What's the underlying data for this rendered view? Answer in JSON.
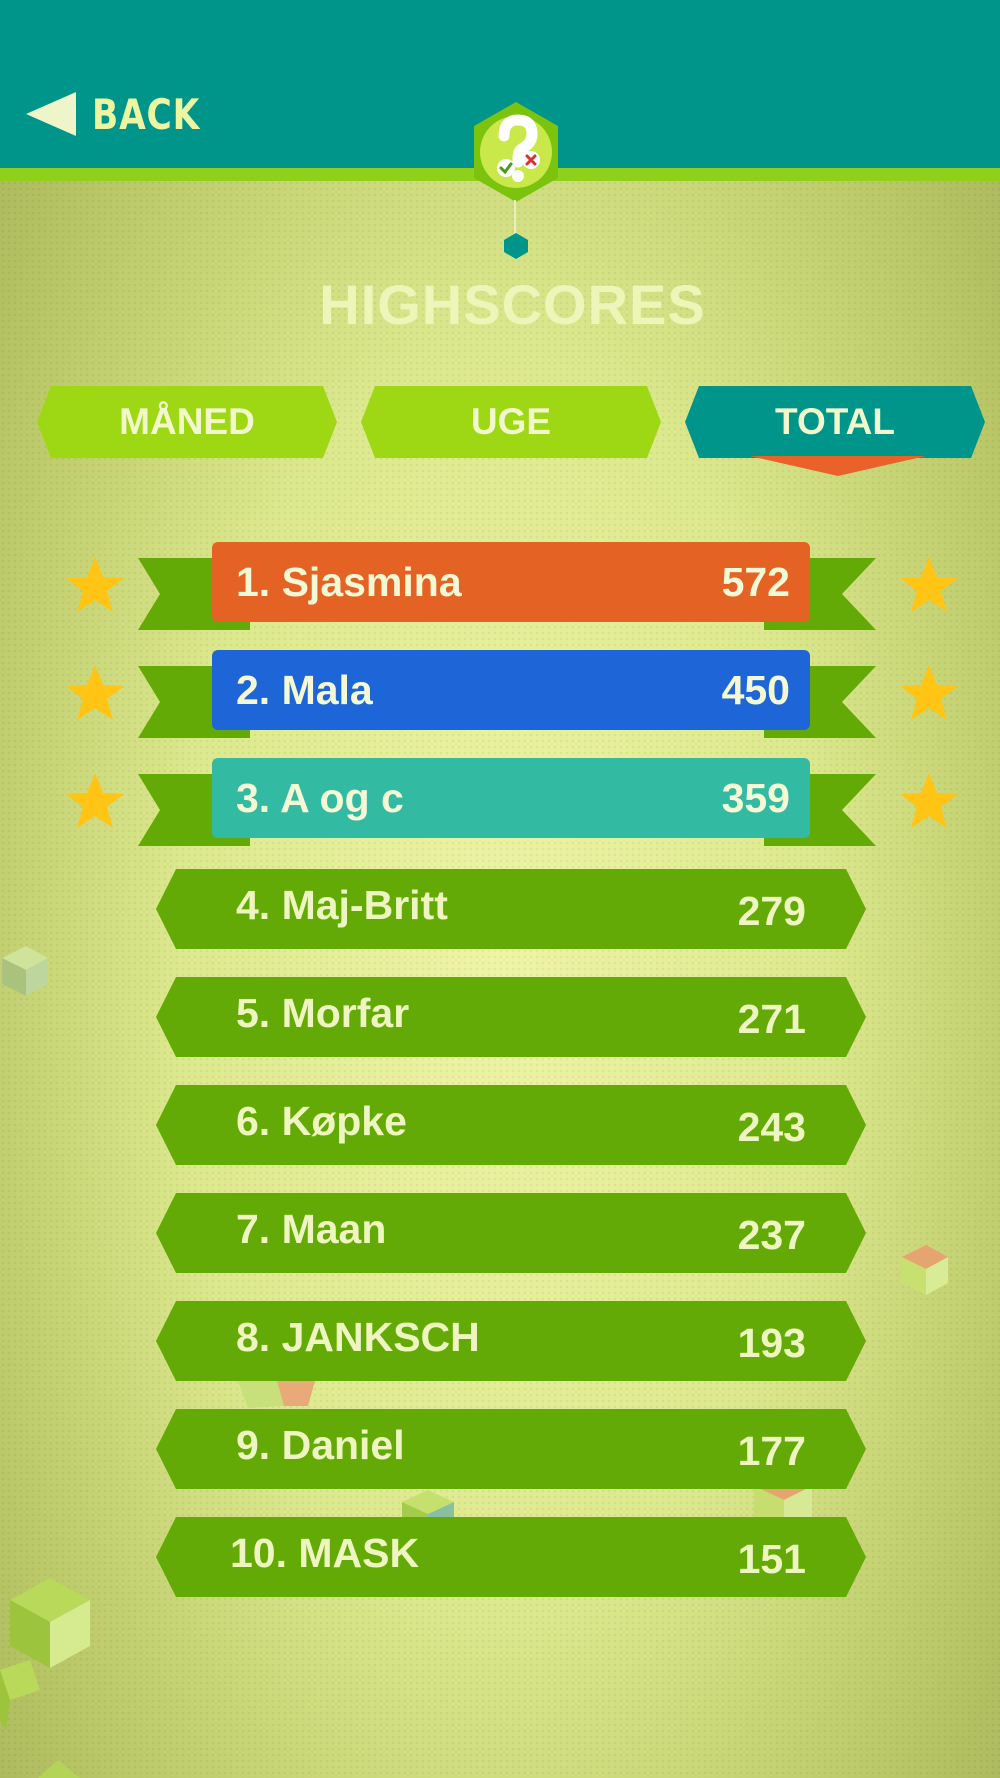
{
  "header": {
    "back_label": "BACK",
    "badge_icon": "quiz-question-icon"
  },
  "title": "HIGHSCORES",
  "tabs": [
    {
      "label": "MÅNED",
      "active": false
    },
    {
      "label": "UGE",
      "active": false
    },
    {
      "label": "TOTAL",
      "active": true
    }
  ],
  "colors": {
    "header": "#00958a",
    "accent_line": "#8fd11a",
    "tab_inactive": "#9ed814",
    "tab_active": "#00958a",
    "tab_pointer": "#e8622a",
    "rank1": "#e56225",
    "rank2": "#1e66d8",
    "rank3": "#33baa2",
    "row": "#64aa06",
    "star": "#ffc414"
  },
  "top3": [
    {
      "name": "1. Sjasmina",
      "score": "572"
    },
    {
      "name": "2. Mala",
      "score": "450"
    },
    {
      "name": "3. A og c",
      "score": "359"
    }
  ],
  "rows": [
    {
      "name": "4. Maj-Britt",
      "score": "279"
    },
    {
      "name": "5. Morfar",
      "score": "271"
    },
    {
      "name": "6. Køpke",
      "score": "243"
    },
    {
      "name": "7. Maan",
      "score": "237"
    },
    {
      "name": "8. JANKSCH",
      "score": "193"
    },
    {
      "name": "9. Daniel",
      "score": "177"
    },
    {
      "name": "10. MASK",
      "score": "151"
    }
  ]
}
